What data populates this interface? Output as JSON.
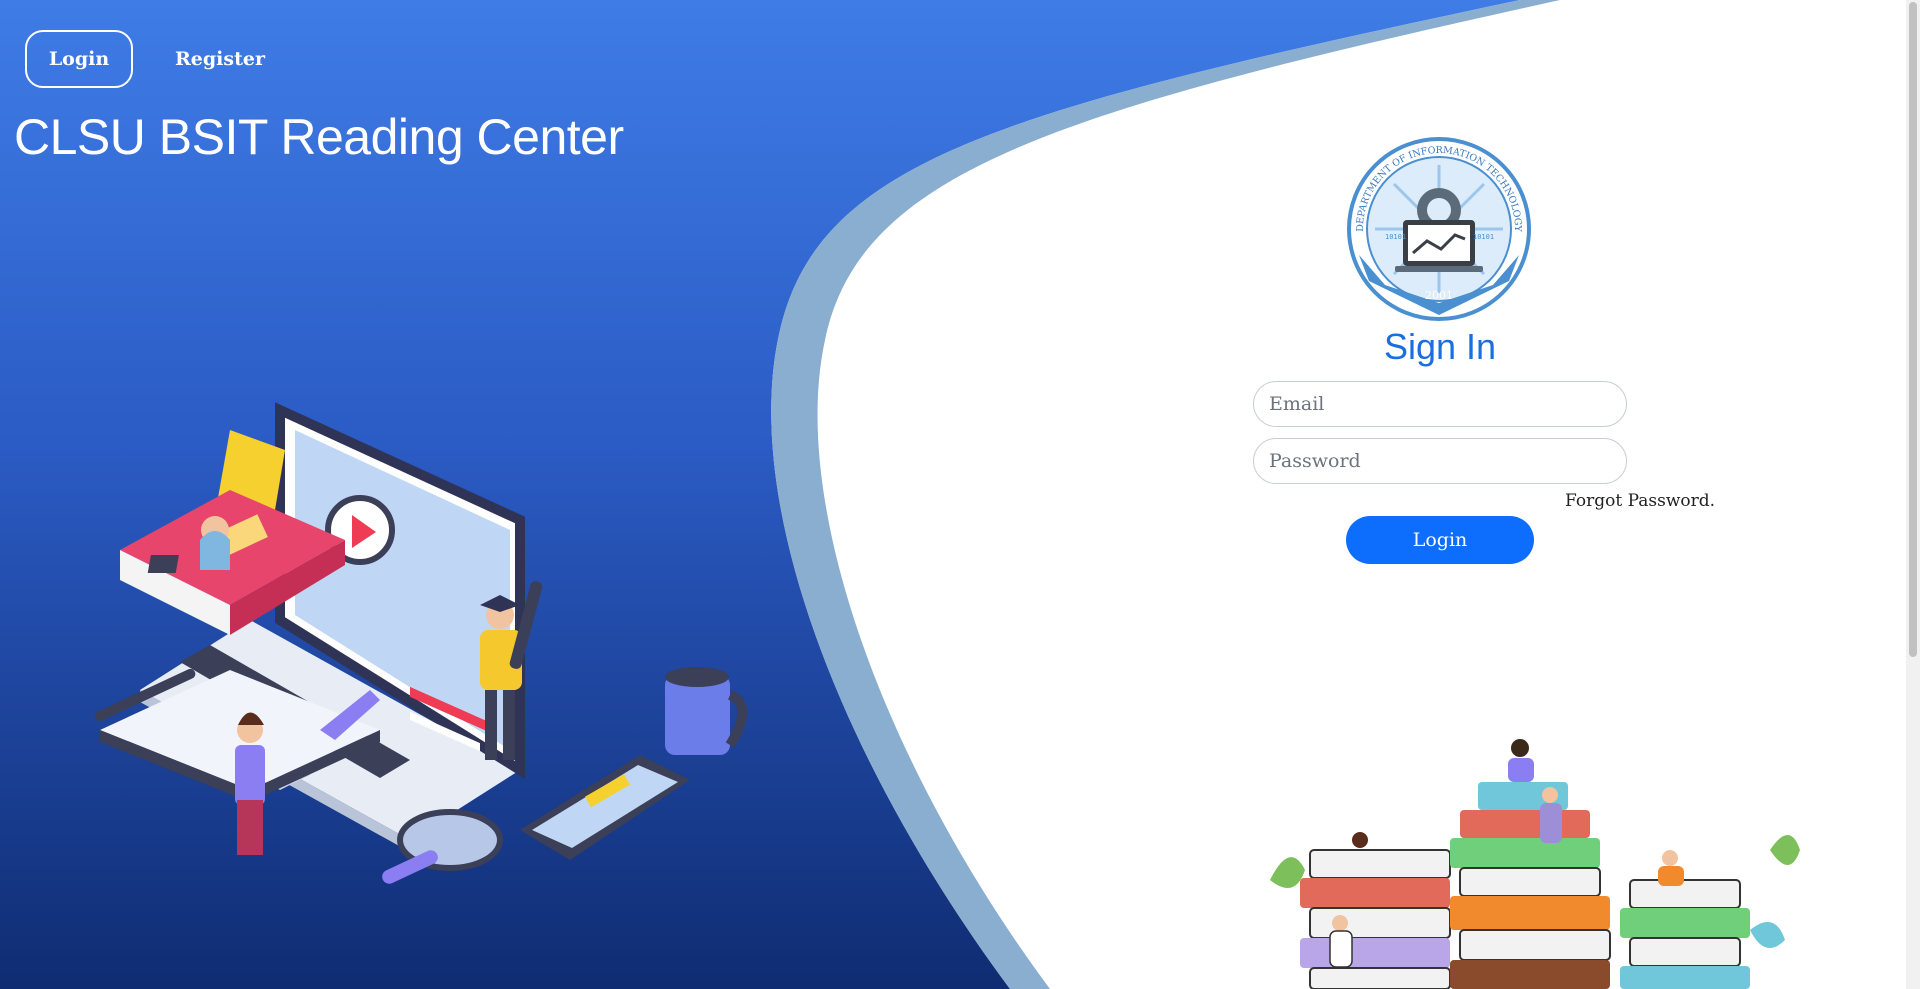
{
  "nav": {
    "login_label": "Login",
    "register_label": "Register"
  },
  "site": {
    "title": "CLSU BSIT Reading Center"
  },
  "logo": {
    "ring_text": "DEPARTMENT OF INFORMATION TECHNOLOGY",
    "year": "2001",
    "binary": "10101"
  },
  "signin": {
    "title": "Sign In",
    "email_placeholder": "Email",
    "password_placeholder": "Password",
    "forgot_label": "Forgot Password.",
    "login_label": "Login"
  },
  "colors": {
    "gradient_top": "#3f7ce6",
    "gradient_bottom": "#0f2c72",
    "curve_band": "#8aaed0",
    "accent": "#0d6efd",
    "title_blue": "#1a6fe0"
  },
  "icons": {
    "hero": "laptop-study-illustration",
    "books": "book-stack-readers-illustration",
    "logo": "department-seal-logo"
  }
}
